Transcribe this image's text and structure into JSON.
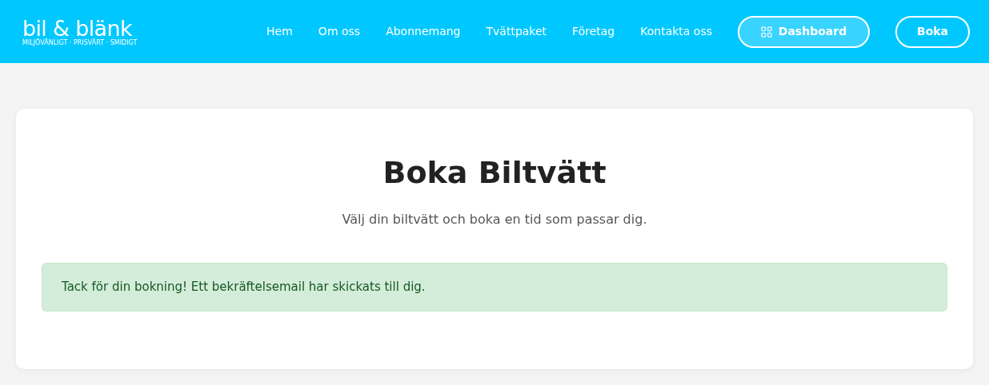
{
  "header": {
    "logo": {
      "name": "bil & blänk",
      "tagline": "MILJÖVÄNLIGT · PRISVÄRT · SMIDIGT"
    },
    "nav": [
      {
        "label": "Hem"
      },
      {
        "label": "Om oss"
      },
      {
        "label": "Abonnemang"
      },
      {
        "label": "Tvättpaket"
      },
      {
        "label": "Företag"
      },
      {
        "label": "Kontakta oss"
      }
    ],
    "buttons": [
      {
        "kind": "dashboard",
        "label": "Dashboard"
      },
      {
        "kind": "plain",
        "label": "Boka"
      }
    ]
  },
  "card": {
    "title": "Boka Biltvätt",
    "subtitle": "Välj din biltvätt och boka en tid som passar dig.",
    "alert": {
      "kind": "success",
      "text": "Tack för din bokning! Ett bekräftelsemail har skickats till dig."
    }
  }
}
